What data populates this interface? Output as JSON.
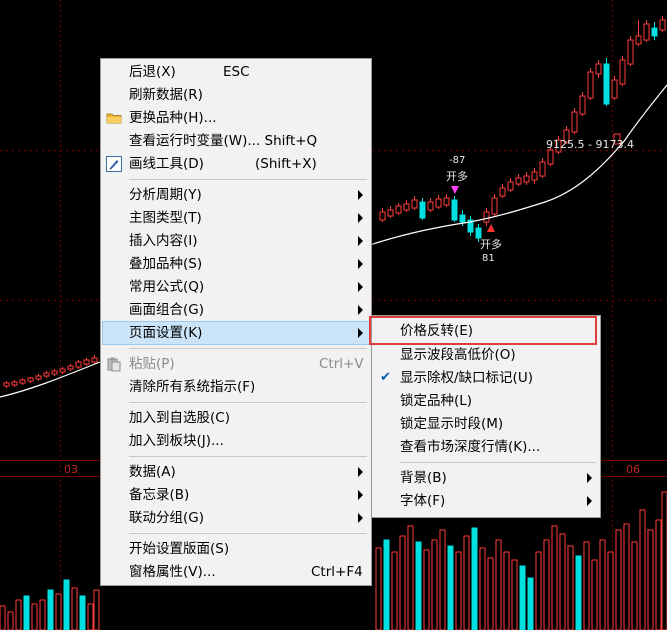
{
  "chart": {
    "price_range_label": "9125.5 - 9173.4",
    "axis_labels": [
      "03",
      "06"
    ],
    "mark_open_label": "开多",
    "mark_open_value": "-87",
    "mark_close_label": "开多",
    "mark_close_value": "81",
    "colors": {
      "up": "#ff3c3c",
      "down": "#00e0e0",
      "ma": "#ffffff",
      "grid": "#7a0000"
    }
  },
  "context_menu": {
    "items": [
      {
        "label": "后退(X)",
        "shortcut": "ESC"
      },
      {
        "label": "刷新数据(R)"
      },
      {
        "label": "更换品种(H)...",
        "icon": "folder-icon"
      },
      {
        "label": "查看运行时变量(W)... Shift+Q"
      },
      {
        "label": "画线工具(D)",
        "shortcut": "(Shift+X)",
        "icon": "pen-icon"
      },
      {
        "label": "分析周期(Y)"
      },
      {
        "label": "主图类型(T)"
      },
      {
        "label": "插入内容(I)"
      },
      {
        "label": "叠加品种(S)"
      },
      {
        "label": "常用公式(Q)"
      },
      {
        "label": "画面组合(G)"
      },
      {
        "label": "页面设置(K)"
      },
      {
        "label": "粘贴(P)",
        "shortcut": "Ctrl+V",
        "icon": "paste-icon"
      },
      {
        "label": "清除所有系统指示(F)"
      },
      {
        "label": "加入到自选股(C)"
      },
      {
        "label": "加入到板块(J)..."
      },
      {
        "label": "数据(A)"
      },
      {
        "label": "备忘录(B)"
      },
      {
        "label": "联动分组(G)"
      },
      {
        "label": "开始设置版面(S)"
      },
      {
        "label": "窗格属性(V)...",
        "shortcut": "Ctrl+F4"
      }
    ]
  },
  "submenu": {
    "items": [
      {
        "label": "价格反转(E)"
      },
      {
        "label": "显示波段高低价(O)"
      },
      {
        "label": "显示除权/缺口标记(U)",
        "checked": true
      },
      {
        "label": "锁定品种(L)"
      },
      {
        "label": "锁定显示时段(M)"
      },
      {
        "label": "查看市场深度行情(K)..."
      },
      {
        "label": "背景(B)"
      },
      {
        "label": "字体(F)"
      }
    ]
  }
}
